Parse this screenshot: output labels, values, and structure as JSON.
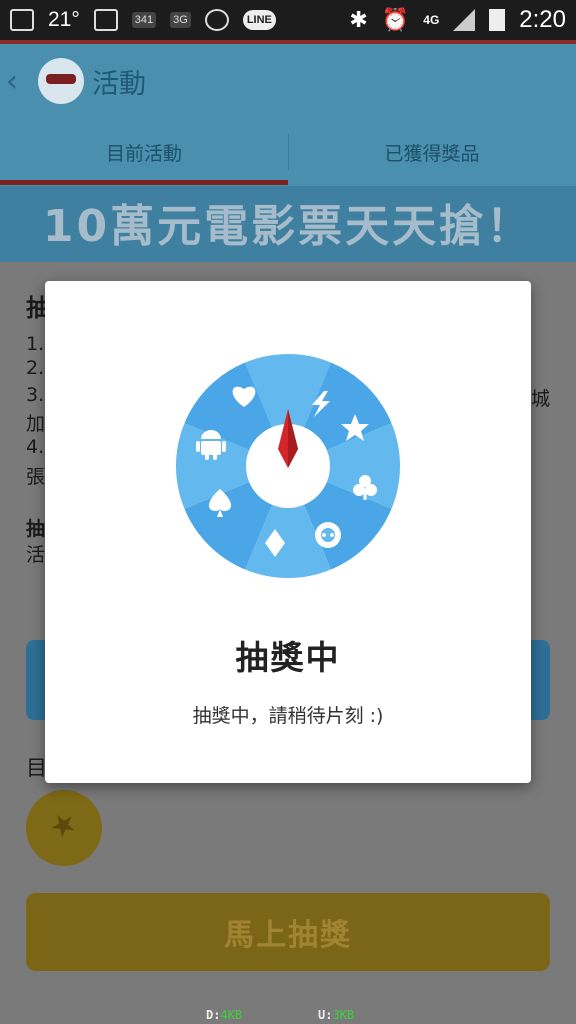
{
  "status_bar": {
    "temperature": "21°",
    "badge_count": "341",
    "network_3g": "3G",
    "line_label": "LINE",
    "network_4g": "4G",
    "time": "2:20"
  },
  "app_bar": {
    "back_glyph": "‹",
    "title": "活動"
  },
  "tabs": [
    {
      "label": "目前活動",
      "selected": true
    },
    {
      "label": "已獲得獎品",
      "selected": false
    }
  ],
  "banner": {
    "text": "10萬元電影票天天搶！"
  },
  "background": {
    "heading_char": "抽",
    "list_numbers": [
      "1.",
      "2.",
      "3.",
      "4."
    ],
    "line3_end": "城",
    "line3_cont": "加",
    "line4_cont": "張",
    "section2_char": "抽",
    "section2_cont": "活",
    "current_char": "目",
    "draw_button_label": "馬上抽獎"
  },
  "traffic": {
    "down_label": "D:",
    "down_value": "4KB",
    "up_label": "U:",
    "up_value": "3KB"
  },
  "dialog": {
    "title": "抽獎中",
    "message": "抽獎中，請稍待片刻 :)",
    "wheel_icons": [
      "lightning-icon",
      "star-icon",
      "club-icon",
      "chat-icon",
      "diamond-icon",
      "spade-icon",
      "android-icon",
      "heart-icon"
    ],
    "colors": {
      "wheel_light": "#63b8ee",
      "wheel_dark": "#4aa6e6",
      "needle": "#d3262b"
    }
  }
}
